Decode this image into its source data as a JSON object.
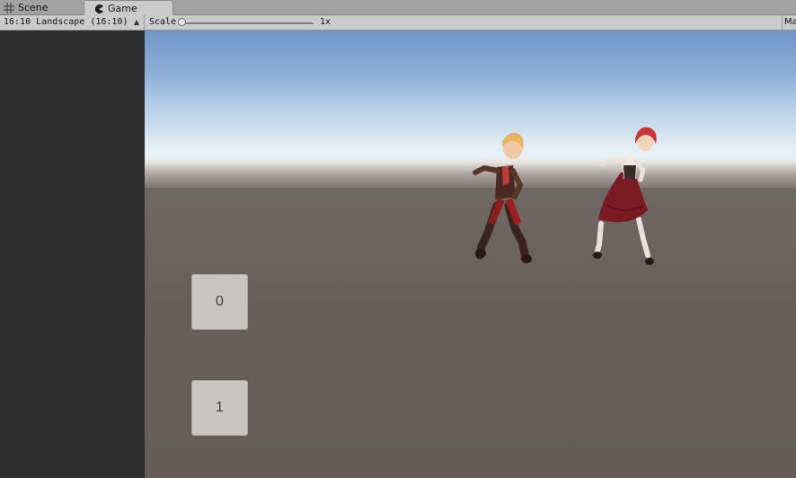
{
  "tabs": {
    "scene": {
      "label": "Scene",
      "icon": "scene-grid-icon"
    },
    "game": {
      "label": "Game",
      "icon": "game-pacman-icon"
    }
  },
  "toolbar": {
    "aspect": "16:10 Landscape (16:10)",
    "scale_label": "Scale",
    "scale_value": "1x",
    "maximize_label": "Maximize On Play"
  },
  "game_view": {
    "buttons": [
      {
        "label": "0"
      },
      {
        "label": "1"
      }
    ],
    "colors": {
      "sky_top": "#6f95c8",
      "horizon": "#f4f6f4",
      "ground": "#665f5b",
      "button_face": "#c8c5c3"
    }
  }
}
